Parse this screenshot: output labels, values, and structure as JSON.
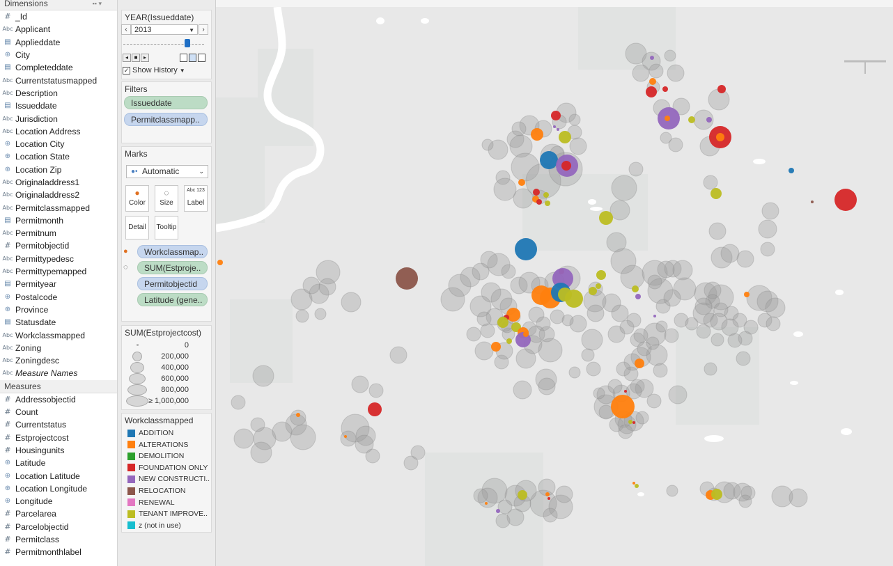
{
  "data_pane": {
    "dimensions_header": "Dimensions",
    "dimensions": [
      {
        "type": "hash",
        "name": "_Id"
      },
      {
        "type": "abc",
        "name": "Applicant"
      },
      {
        "type": "cal",
        "name": "Applieddate"
      },
      {
        "type": "globe",
        "name": "City"
      },
      {
        "type": "cal",
        "name": "Completeddate"
      },
      {
        "type": "abc",
        "name": "Currentstatusmapped"
      },
      {
        "type": "abc",
        "name": "Description"
      },
      {
        "type": "cal",
        "name": "Issueddate"
      },
      {
        "type": "abc",
        "name": "Jurisdiction"
      },
      {
        "type": "abc",
        "name": "Location Address"
      },
      {
        "type": "globe",
        "name": "Location City"
      },
      {
        "type": "globe",
        "name": "Location State"
      },
      {
        "type": "globe",
        "name": "Location Zip"
      },
      {
        "type": "abc",
        "name": "Originaladdress1"
      },
      {
        "type": "abc",
        "name": "Originaladdress2"
      },
      {
        "type": "abc",
        "name": "Permitclassmapped"
      },
      {
        "type": "cal",
        "name": "Permitmonth"
      },
      {
        "type": "abc",
        "name": "Permitnum"
      },
      {
        "type": "hash",
        "name": "Permitobjectid"
      },
      {
        "type": "abc",
        "name": "Permittypedesc"
      },
      {
        "type": "abc",
        "name": "Permittypemapped"
      },
      {
        "type": "cal",
        "name": "Permityear"
      },
      {
        "type": "globe",
        "name": "Postalcode"
      },
      {
        "type": "globe",
        "name": "Province"
      },
      {
        "type": "cal",
        "name": "Statusdate"
      },
      {
        "type": "abc",
        "name": "Workclassmapped"
      },
      {
        "type": "abc",
        "name": "Zoning"
      },
      {
        "type": "abc",
        "name": "Zoningdesc"
      },
      {
        "type": "abc",
        "name": "Measure Names",
        "italic": true
      }
    ],
    "measures_header": "Measures",
    "measures": [
      {
        "type": "hash",
        "name": "Addressobjectid"
      },
      {
        "type": "hash",
        "name": "Count"
      },
      {
        "type": "hash",
        "name": "Currentstatus"
      },
      {
        "type": "hash",
        "name": "Estprojectcost"
      },
      {
        "type": "hash",
        "name": "Housingunits"
      },
      {
        "type": "globe",
        "name": "Latitude"
      },
      {
        "type": "globe",
        "name": "Location Latitude"
      },
      {
        "type": "globe",
        "name": "Location Longitude"
      },
      {
        "type": "globe",
        "name": "Longitude"
      },
      {
        "type": "hash",
        "name": "Parcelarea"
      },
      {
        "type": "hash",
        "name": "Parcelobjectid"
      },
      {
        "type": "hash",
        "name": "Permitclass"
      },
      {
        "type": "hash",
        "name": "Permitmonthlabel"
      }
    ],
    "type_glyphs": {
      "hash": "#",
      "abc": "Abc",
      "globe": "⊕",
      "cal": "▤"
    }
  },
  "pages_card": {
    "title": "YEAR(Issueddate)",
    "selected_year": "2013",
    "show_history_label": "Show History",
    "show_history_checked": true
  },
  "filters_card": {
    "title": "Filters",
    "pills": [
      "Issueddate",
      "Permitclassmapp.."
    ]
  },
  "marks_card": {
    "title": "Marks",
    "mark_type": "Automatic",
    "buttons": [
      "Color",
      "Size",
      "Label",
      "Detail",
      "Tooltip"
    ],
    "label_glyph": "Abc 123",
    "shelf_pills": [
      "Workclassmap..",
      "SUM(Estproje..",
      "Permitobjectid",
      "Latitude (gene.."
    ]
  },
  "size_legend": {
    "title": "SUM(Estprojectcost)",
    "labels": [
      "0",
      "200,000",
      "400,000",
      "600,000",
      "800,000",
      "≥ 1,000,000"
    ]
  },
  "color_legend": {
    "title": "Workclassmapped",
    "items": [
      {
        "label": "ADDITION",
        "color": "#1f77b4"
      },
      {
        "label": "ALTERATIONS",
        "color": "#ff7f0e"
      },
      {
        "label": "DEMOLITION",
        "color": "#2ca02c"
      },
      {
        "label": "FOUNDATION ONLY",
        "color": "#d62728"
      },
      {
        "label": "NEW CONSTRUCTI..",
        "color": "#9467bd"
      },
      {
        "label": "RELOCATION",
        "color": "#8c564b"
      },
      {
        "label": "RENEWAL",
        "color": "#e377c2"
      },
      {
        "label": "TENANT IMPROVE..",
        "color": "#bcbd22"
      },
      {
        "label": "z (not in use)",
        "color": "#17becf"
      }
    ]
  },
  "map_colors": {
    "history": "#9a9a9a",
    "background": "#e8e8e8",
    "river": "#ffffff",
    "water": "#ffffff"
  }
}
